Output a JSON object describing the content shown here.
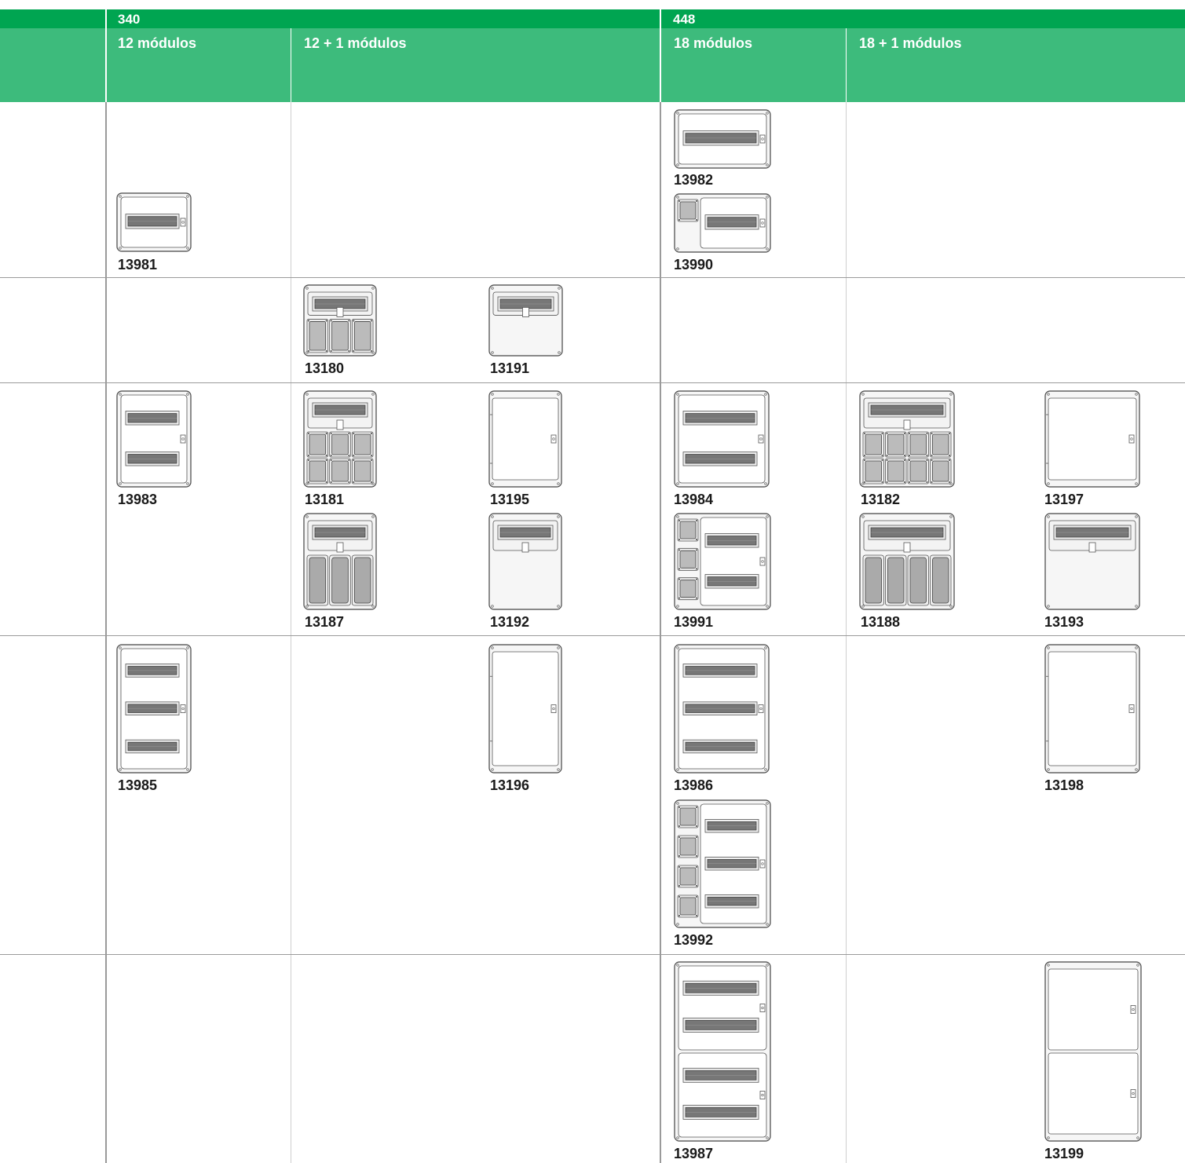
{
  "header": {
    "group_340": "340",
    "group_448": "448",
    "col_12": "12 módulos",
    "col_12_1": "12 + 1 módulos",
    "col_18": "18 módulos",
    "col_18_1": "18 + 1 módulos"
  },
  "colors": {
    "header_dark": "#00a551",
    "header_light": "#3dbb7c",
    "grid_line": "#9a9a9a"
  },
  "products": [
    {
      "code": "13981",
      "type": "rail-panel",
      "rails": 1,
      "sockets": 0
    },
    {
      "code": "13982",
      "type": "rail-panel",
      "rails": 1,
      "sockets": 0
    },
    {
      "code": "13990",
      "type": "socket-rail-panel",
      "rails": 1,
      "sockets": 1
    },
    {
      "code": "13180",
      "type": "top-rail-sockets",
      "socket_rows": 1,
      "socket_cols": 3
    },
    {
      "code": "13191",
      "type": "top-rail-blank",
      "rails": 1
    },
    {
      "code": "13983",
      "type": "rail-panel",
      "rails": 2
    },
    {
      "code": "13181",
      "type": "top-rail-sockets",
      "socket_rows": 2,
      "socket_cols": 3
    },
    {
      "code": "13195",
      "type": "door"
    },
    {
      "code": "13984",
      "type": "rail-panel",
      "rails": 2
    },
    {
      "code": "13182",
      "type": "top-rail-sockets",
      "socket_rows": 2,
      "socket_cols": 4
    },
    {
      "code": "13197",
      "type": "door"
    },
    {
      "code": "13187",
      "type": "top-rail-tall-sockets",
      "socket_cols": 3
    },
    {
      "code": "13192",
      "type": "top-rail-blank",
      "rails": 1
    },
    {
      "code": "13991",
      "type": "socket-rail-panel",
      "rails": 2,
      "sockets": 3
    },
    {
      "code": "13188",
      "type": "top-rail-tall-sockets",
      "socket_cols": 4
    },
    {
      "code": "13193",
      "type": "top-rail-blank",
      "rails": 1
    },
    {
      "code": "13985",
      "type": "rail-panel",
      "rails": 3
    },
    {
      "code": "13196",
      "type": "door"
    },
    {
      "code": "13986",
      "type": "rail-panel",
      "rails": 3
    },
    {
      "code": "13198",
      "type": "door"
    },
    {
      "code": "13992",
      "type": "socket-rail-panel",
      "rails": 3,
      "sockets": 4
    },
    {
      "code": "13987",
      "type": "double-rail-panel",
      "rails": 4
    },
    {
      "code": "13199",
      "type": "double-door"
    }
  ]
}
